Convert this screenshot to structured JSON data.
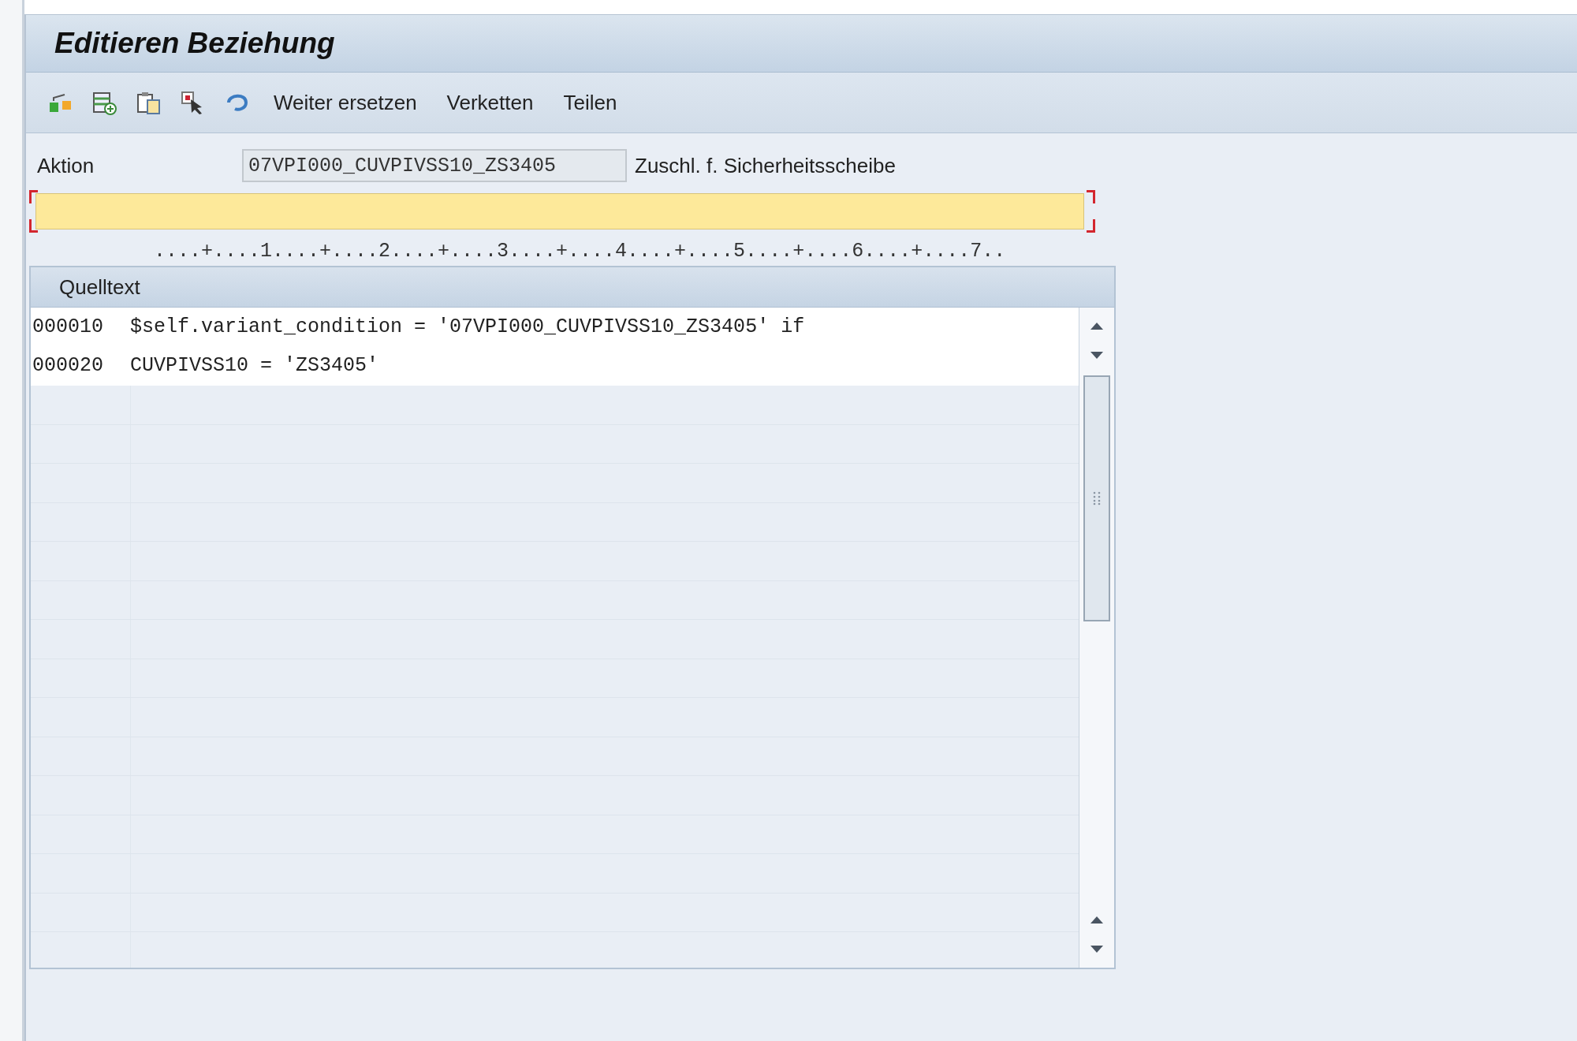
{
  "title": "Editieren Beziehung",
  "toolbar": {
    "buttons": [
      "Weiter ersetzen",
      "Verketten",
      "Teilen"
    ]
  },
  "action": {
    "label": "Aktion",
    "value": "07VPI000_CUVPIVSS10_ZS3405",
    "description": "Zuschl. f. Sicherheitsscheibe"
  },
  "ruler": "....+....1....+....2....+....3....+....4....+....5....+....6....+....7..",
  "editor": {
    "title": "Quelltext",
    "lines": [
      {
        "number": "000010",
        "code": "$self.variant_condition = '07VPI000_CUVPIVSS10_ZS3405' if"
      },
      {
        "number": "000020",
        "code": "CUVPIVSS10 = 'ZS3405'"
      }
    ]
  }
}
